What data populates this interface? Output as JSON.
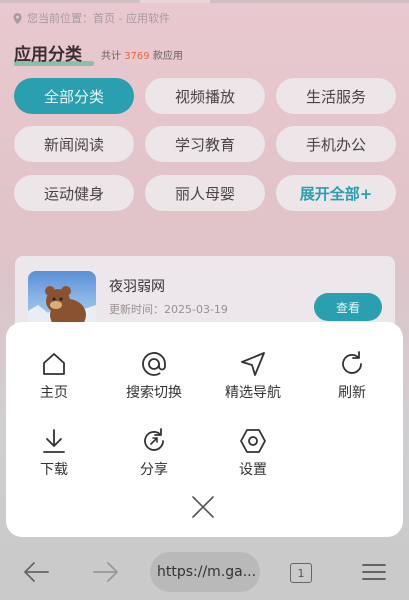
{
  "location": {
    "text": "您当前位置：首页 - 应用软件"
  },
  "category": {
    "title": "应用分类",
    "count_prefix": "共计 ",
    "count": "3769",
    "count_suffix": " 款应用",
    "chips": [
      {
        "label": "全部分类",
        "active": true
      },
      {
        "label": "视频播放"
      },
      {
        "label": "生活服务"
      },
      {
        "label": "新闻阅读"
      },
      {
        "label": "学习教育"
      },
      {
        "label": "手机办公"
      },
      {
        "label": "运动健身"
      },
      {
        "label": "丽人母婴"
      },
      {
        "label": "展开全部+",
        "more": true
      }
    ]
  },
  "app_card": {
    "name": "夜羽弱网",
    "update_prefix": "更新时间：",
    "update_date": "2025-03-19",
    "view_label": "查看"
  },
  "menu": {
    "items": [
      {
        "label": "主页",
        "icon": "home-icon"
      },
      {
        "label": "搜索切换",
        "icon": "at-icon"
      },
      {
        "label": "精选导航",
        "icon": "navigation-arrow-icon"
      },
      {
        "label": "刷新",
        "icon": "refresh-icon"
      },
      {
        "label": "下载",
        "icon": "download-icon"
      },
      {
        "label": "分享",
        "icon": "share-icon"
      },
      {
        "label": "设置",
        "icon": "settings-hexagon-icon"
      }
    ],
    "close_icon": "close-icon"
  },
  "browser": {
    "url": "https://m.ga...",
    "tab_count": "1"
  },
  "colors": {
    "accent": "#2a9fb0",
    "count_highlight": "#e06a4a",
    "title_underline": "#3fb98a"
  }
}
